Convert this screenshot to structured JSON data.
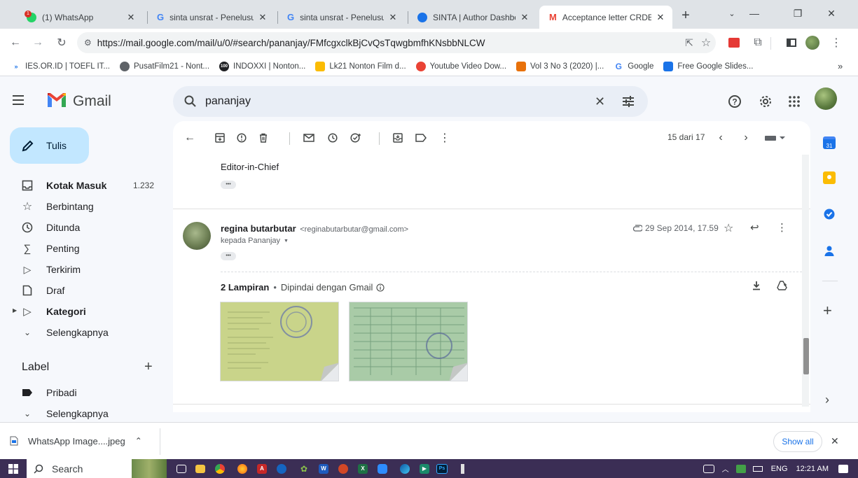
{
  "browser": {
    "tabs": [
      {
        "title": "(1) WhatsApp",
        "active": false
      },
      {
        "title": "sinta unsrat - Penelusur",
        "active": false
      },
      {
        "title": "sinta unsrat - Penelusur",
        "active": false
      },
      {
        "title": "SINTA | Author Dashbo",
        "active": false
      },
      {
        "title": "Acceptance letter CRDE",
        "active": true
      }
    ],
    "new_tab": "+",
    "url": "https://mail.google.com/mail/u/0/#search/pananjay/FMfcgxclkBjCvQsTqwgbmfhKNsbbNLCW",
    "bookmarks": [
      "IES.OR.ID | TOEFL IT...",
      "PusatFilm21 - Nont...",
      "INDOXXI | Nonton...",
      "Lk21 Nonton Film d...",
      "Youtube Video Dow...",
      "Vol 3 No 3 (2020) |...",
      "Google",
      "Free Google Slides..."
    ],
    "bookmarks_more": "»"
  },
  "gmail": {
    "brand": "Gmail",
    "search_query": "pananjay",
    "compose_label": "Tulis",
    "nav": [
      {
        "label": "Kotak Masuk",
        "count": "1.232",
        "bold": true,
        "icon": "inbox-icon"
      },
      {
        "label": "Berbintang",
        "count": "",
        "bold": false,
        "icon": "star-icon"
      },
      {
        "label": "Ditunda",
        "count": "",
        "bold": false,
        "icon": "clock-icon"
      },
      {
        "label": "Penting",
        "count": "",
        "bold": false,
        "icon": "important-icon"
      },
      {
        "label": "Terkirim",
        "count": "",
        "bold": false,
        "icon": "send-icon"
      },
      {
        "label": "Draf",
        "count": "",
        "bold": false,
        "icon": "draft-icon"
      },
      {
        "label": "Kategori",
        "count": "",
        "bold": true,
        "icon": "label-icon"
      },
      {
        "label": "Selengkapnya",
        "count": "",
        "bold": false,
        "icon": "chevron-down-icon"
      }
    ],
    "labels_heading": "Label",
    "labels_add": "+",
    "labels": [
      {
        "label": "Pribadi",
        "icon": "label-filled-icon"
      },
      {
        "label": "Selengkapnya",
        "icon": "chevron-down-icon"
      }
    ],
    "pagination": "15 dari 17",
    "prev_message_signature": "Editor-in-Chief",
    "ellipsis": "•••",
    "message": {
      "sender_name": "regina butarbutar",
      "sender_email": "<reginabutarbutar@gmail.com>",
      "recipient": "kepada Pananjay",
      "date": "29 Sep 2014, 17.59",
      "attachments_heading": "2 Lampiran",
      "attachments_dot": "•",
      "scan_note": "Dipindai dengan Gmail"
    }
  },
  "download_bar": {
    "file": "WhatsApp Image....jpeg",
    "show_all": "Show all",
    "close": "✕"
  },
  "taskbar": {
    "search": "Search",
    "language": "ENG",
    "time": "12:21 AM"
  }
}
